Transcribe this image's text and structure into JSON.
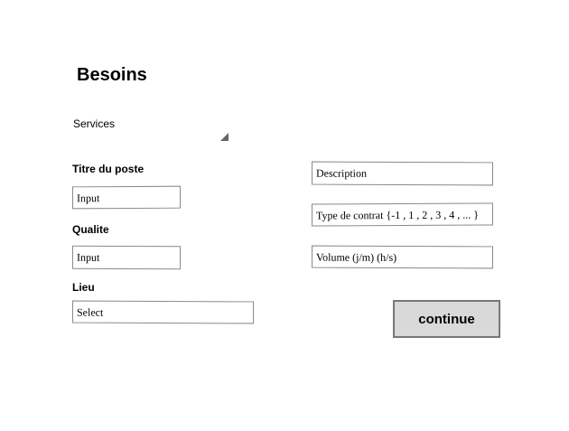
{
  "page": {
    "title": "Besoins"
  },
  "services": {
    "label": "Services",
    "arrow_icon": "corner-triangle-icon"
  },
  "fields": {
    "titre_du_poste": {
      "label": "Titre du poste",
      "value": "Input"
    },
    "qualite": {
      "label": "Qualite",
      "value": "Input"
    },
    "lieu": {
      "label": "Lieu",
      "value": "Select"
    },
    "description": {
      "value": "Description"
    },
    "type_de_contrat": {
      "value": "Type de contrat {-1 , 1 , 2 , 3 , 4 , ... }"
    },
    "volume": {
      "value": "Volume (j/m) (h/s)"
    }
  },
  "actions": {
    "continue_label": "continue"
  },
  "colors": {
    "button_bg": "#d9d9d9",
    "button_border": "#777777",
    "input_border": "#8a8a8a"
  }
}
